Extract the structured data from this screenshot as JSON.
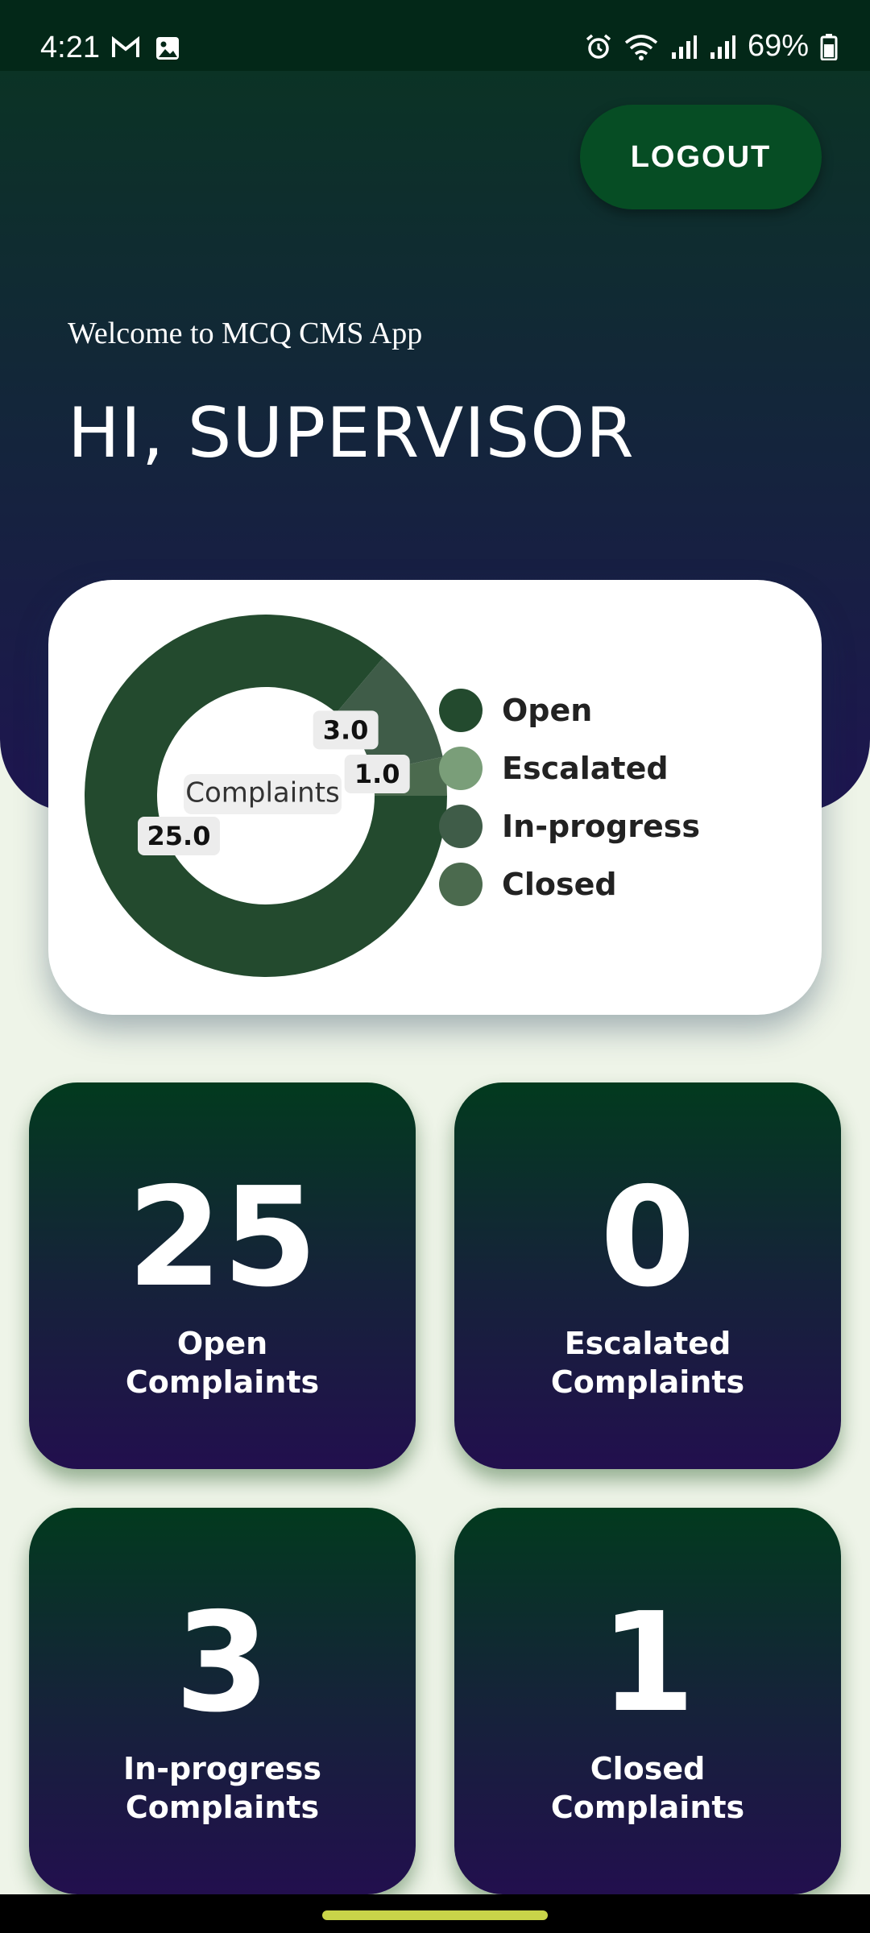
{
  "status_bar": {
    "time": "4:21",
    "battery": "69%",
    "icons": [
      "gmail-icon",
      "gallery-icon",
      "alarm-icon",
      "wifi-icon",
      "signal-icon",
      "signal-icon",
      "battery-icon"
    ]
  },
  "header": {
    "logout_label": "LOGOUT",
    "welcome": "Welcome to MCQ CMS App",
    "greeting": "HI, SUPERVISOR"
  },
  "chart_data": {
    "type": "pie",
    "center_label": "Complaints",
    "categories": [
      "Open",
      "Escalated",
      "In-progress",
      "Closed"
    ],
    "values": [
      25,
      0,
      3,
      1
    ],
    "data_labels": [
      "25.0",
      "",
      "3.0",
      "1.0"
    ],
    "colors": [
      "#234a2e",
      "#7a9e79",
      "#3f5c48",
      "#4b6a4e"
    ],
    "legend_position": "right"
  },
  "stats": [
    {
      "value": "25",
      "label_line1": "Open",
      "label_line2": "Complaints"
    },
    {
      "value": "0",
      "label_line1": "Escalated",
      "label_line2": "Complaints"
    },
    {
      "value": "3",
      "label_line1": "In-progress",
      "label_line2": "Complaints"
    },
    {
      "value": "1",
      "label_line1": "Closed",
      "label_line2": "Complaints"
    }
  ],
  "colors": {
    "status_bar": "#032818",
    "logout_button": "#064d24",
    "card_gradient_top": "#023a1e",
    "card_gradient_bottom": "#220f4e",
    "background": "#eef4e8"
  }
}
